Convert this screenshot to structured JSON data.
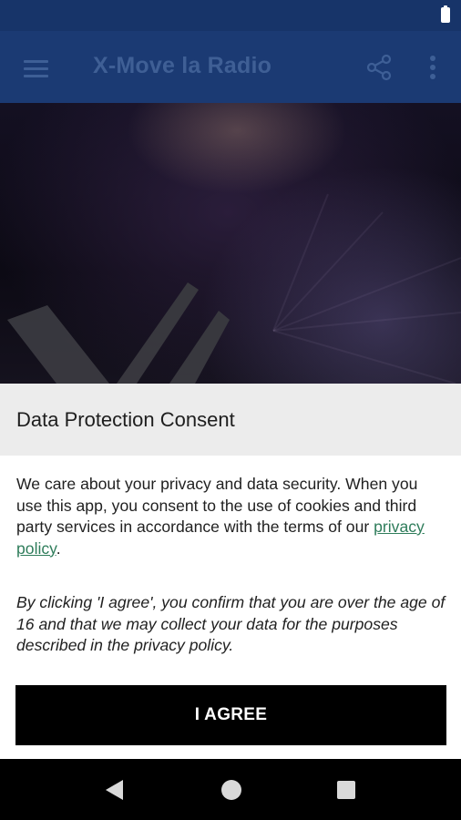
{
  "app_bar": {
    "title": "X-Move la Radio",
    "menu_icon": "hamburger-menu-icon",
    "share_icon": "share-icon",
    "more_icon": "more-vert-icon"
  },
  "status_bar": {
    "battery_icon": "battery-icon"
  },
  "consent": {
    "title": "Data Protection Consent",
    "body_before_link": "We care about your privacy and data security. When you use this app, you consent to the use of cookies and third party services in accordance with the terms of our ",
    "link_label": "privacy policy",
    "body_after_link": ".",
    "italic_notice": "By clicking 'I agree', you confirm that you are over the age of 16 and that we may collect your data for the purposes described in the privacy policy.",
    "agree_label": "I AGREE"
  },
  "nav_bar": {
    "back_icon": "back-triangle-icon",
    "home_icon": "home-circle-icon",
    "recents_icon": "recents-square-icon"
  },
  "colors": {
    "status_bar": "#173469",
    "app_bar": "#1b3a73",
    "app_bar_foreground": "#3f5f95",
    "consent_header": "#ececec",
    "link": "#2f7d5b",
    "button": "#000000"
  }
}
